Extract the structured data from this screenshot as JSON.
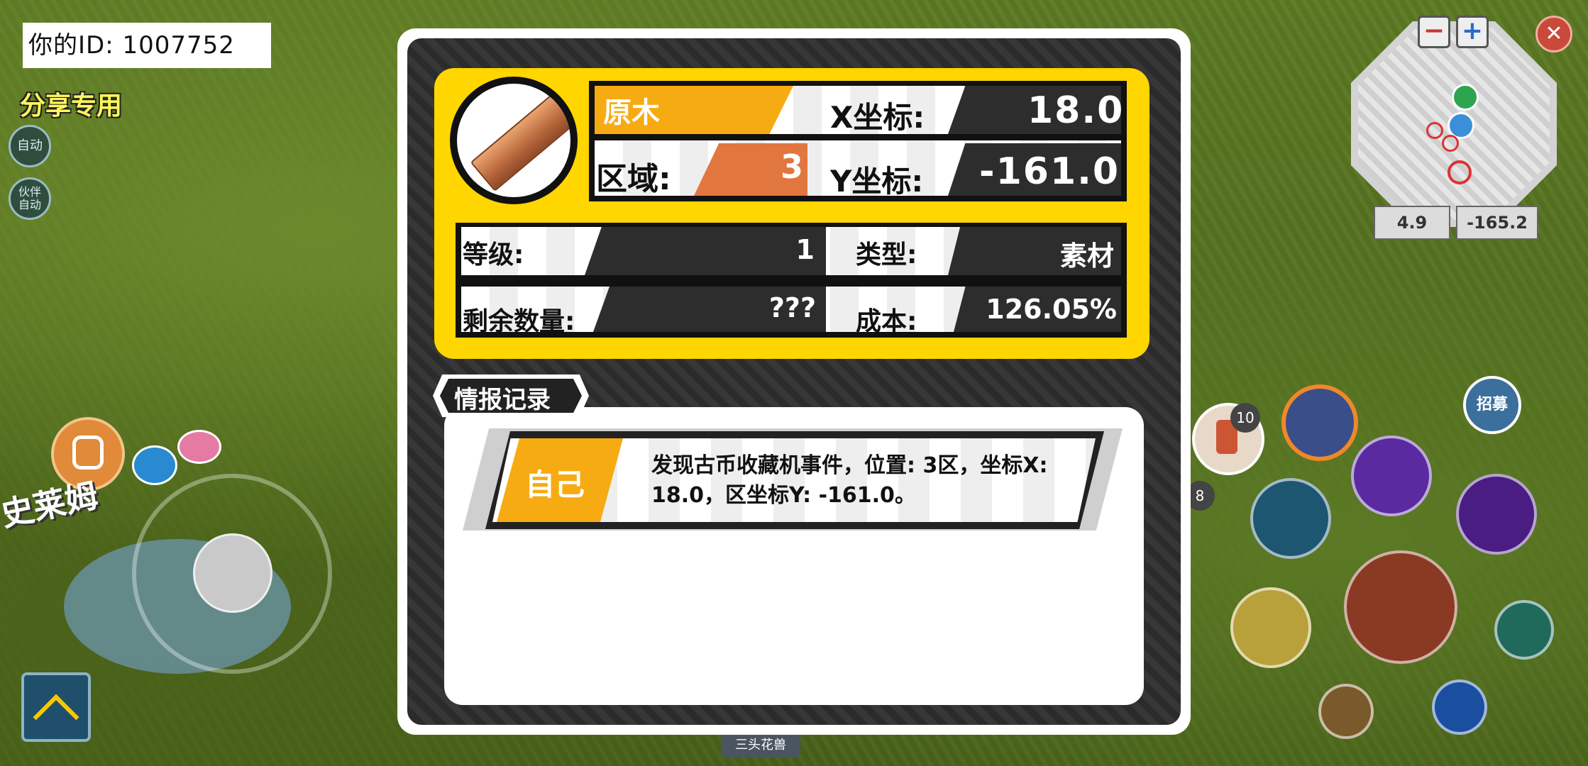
{
  "hud": {
    "player_id": "你的ID: 1007752",
    "share_label": "分享专用",
    "auto_label": "自动",
    "partner_auto_label": "伙伴\n自动",
    "scene_text": "史莱姆",
    "bottom_target": "三头花兽",
    "skill_count": "10",
    "skill_count2": "8",
    "recruit_label": "招募"
  },
  "minimap": {
    "zoom_out": "−",
    "zoom_in": "+",
    "close": "✕",
    "x_readout": "4.9",
    "y_readout": "-165.2"
  },
  "item": {
    "name": "原木",
    "zone_label": "区域:",
    "zone_value": "3",
    "x_label": "X坐标:",
    "x_value": "18.0",
    "y_label": "Y坐标:",
    "y_value": "-161.0",
    "level_label": "等级:",
    "level_value": "1",
    "type_label": "类型:",
    "type_value": "素材",
    "remaining_label": "剩余数量:",
    "remaining_value": "???",
    "cost_label": "成本:",
    "cost_value": "126.05%"
  },
  "log": {
    "tab_title": "情报记录",
    "entries": [
      {
        "source": "自己",
        "text": "发现古币收藏机事件，位置: 3区，坐标X: 18.0，区坐标Y: -161.0。"
      }
    ]
  },
  "colors": {
    "accent_yellow": "#ffd600",
    "accent_orange": "#f7ab12",
    "zone_orange": "#e2763f",
    "panel_dark": "#2b2b2b"
  }
}
